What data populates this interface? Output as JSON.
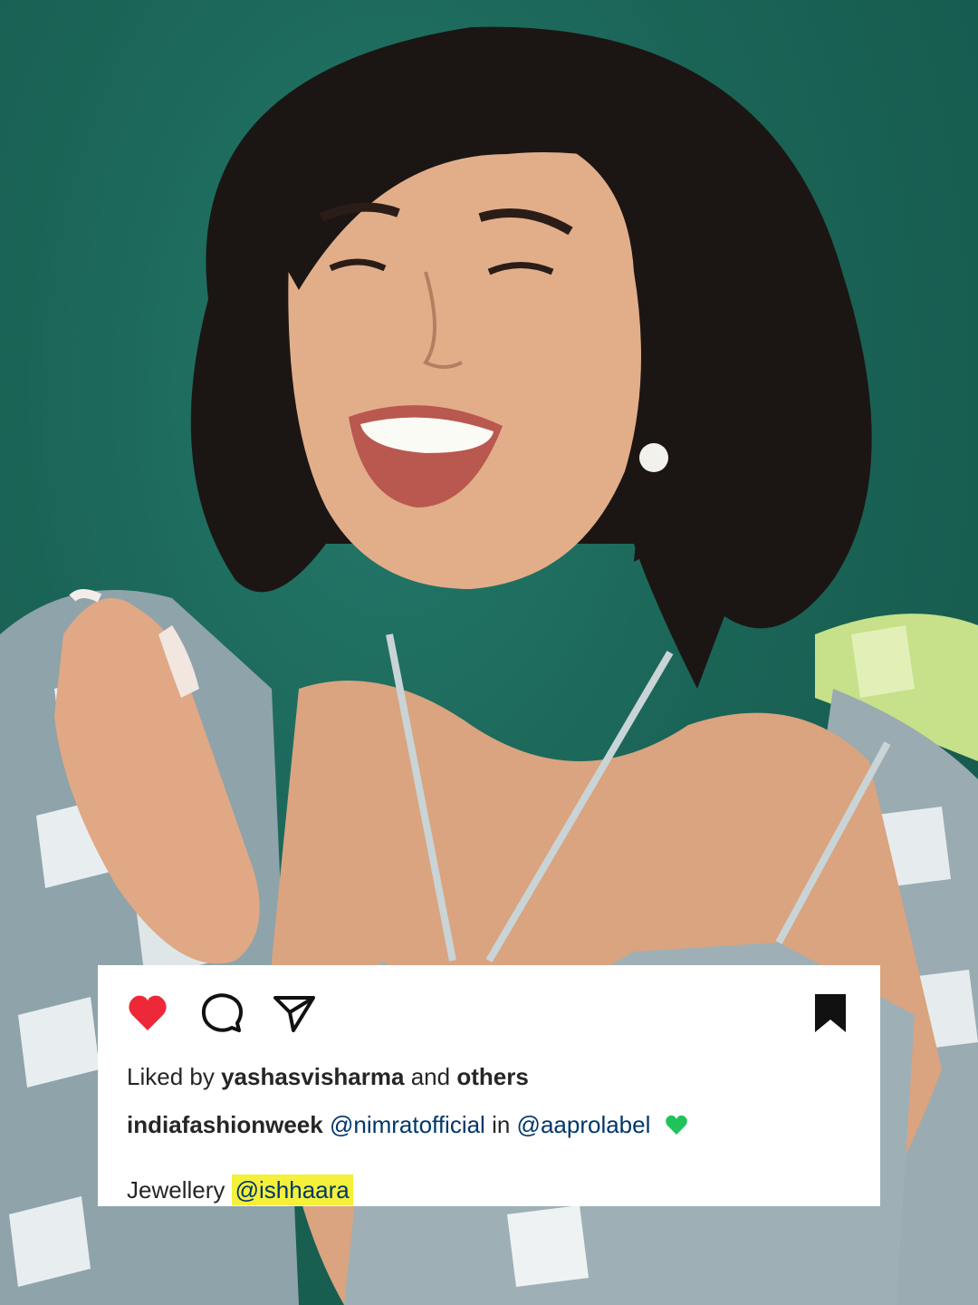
{
  "post": {
    "liked": {
      "prefix": "Liked by",
      "user": "yashasvisharma",
      "connector": "and",
      "others": "others"
    },
    "caption": {
      "author": "indiafashionweek",
      "mention_1": "@nimratofficial",
      "connector": "in",
      "mention_2": "@aaprolabel"
    },
    "jewellery": {
      "label": "Jewellery",
      "mention": "@ishhaara"
    }
  },
  "icons": {
    "like": "heart-icon",
    "comment": "comment-icon",
    "share": "send-icon",
    "save": "bookmark-icon",
    "emoji": "green-heart-icon"
  },
  "colors": {
    "background": "#1c6a5b",
    "card": "#ffffff",
    "like_red": "#ed2939",
    "mention_blue": "#00376b",
    "highlight_yellow": "#f5f03a",
    "emoji_green": "#1ec45a"
  }
}
